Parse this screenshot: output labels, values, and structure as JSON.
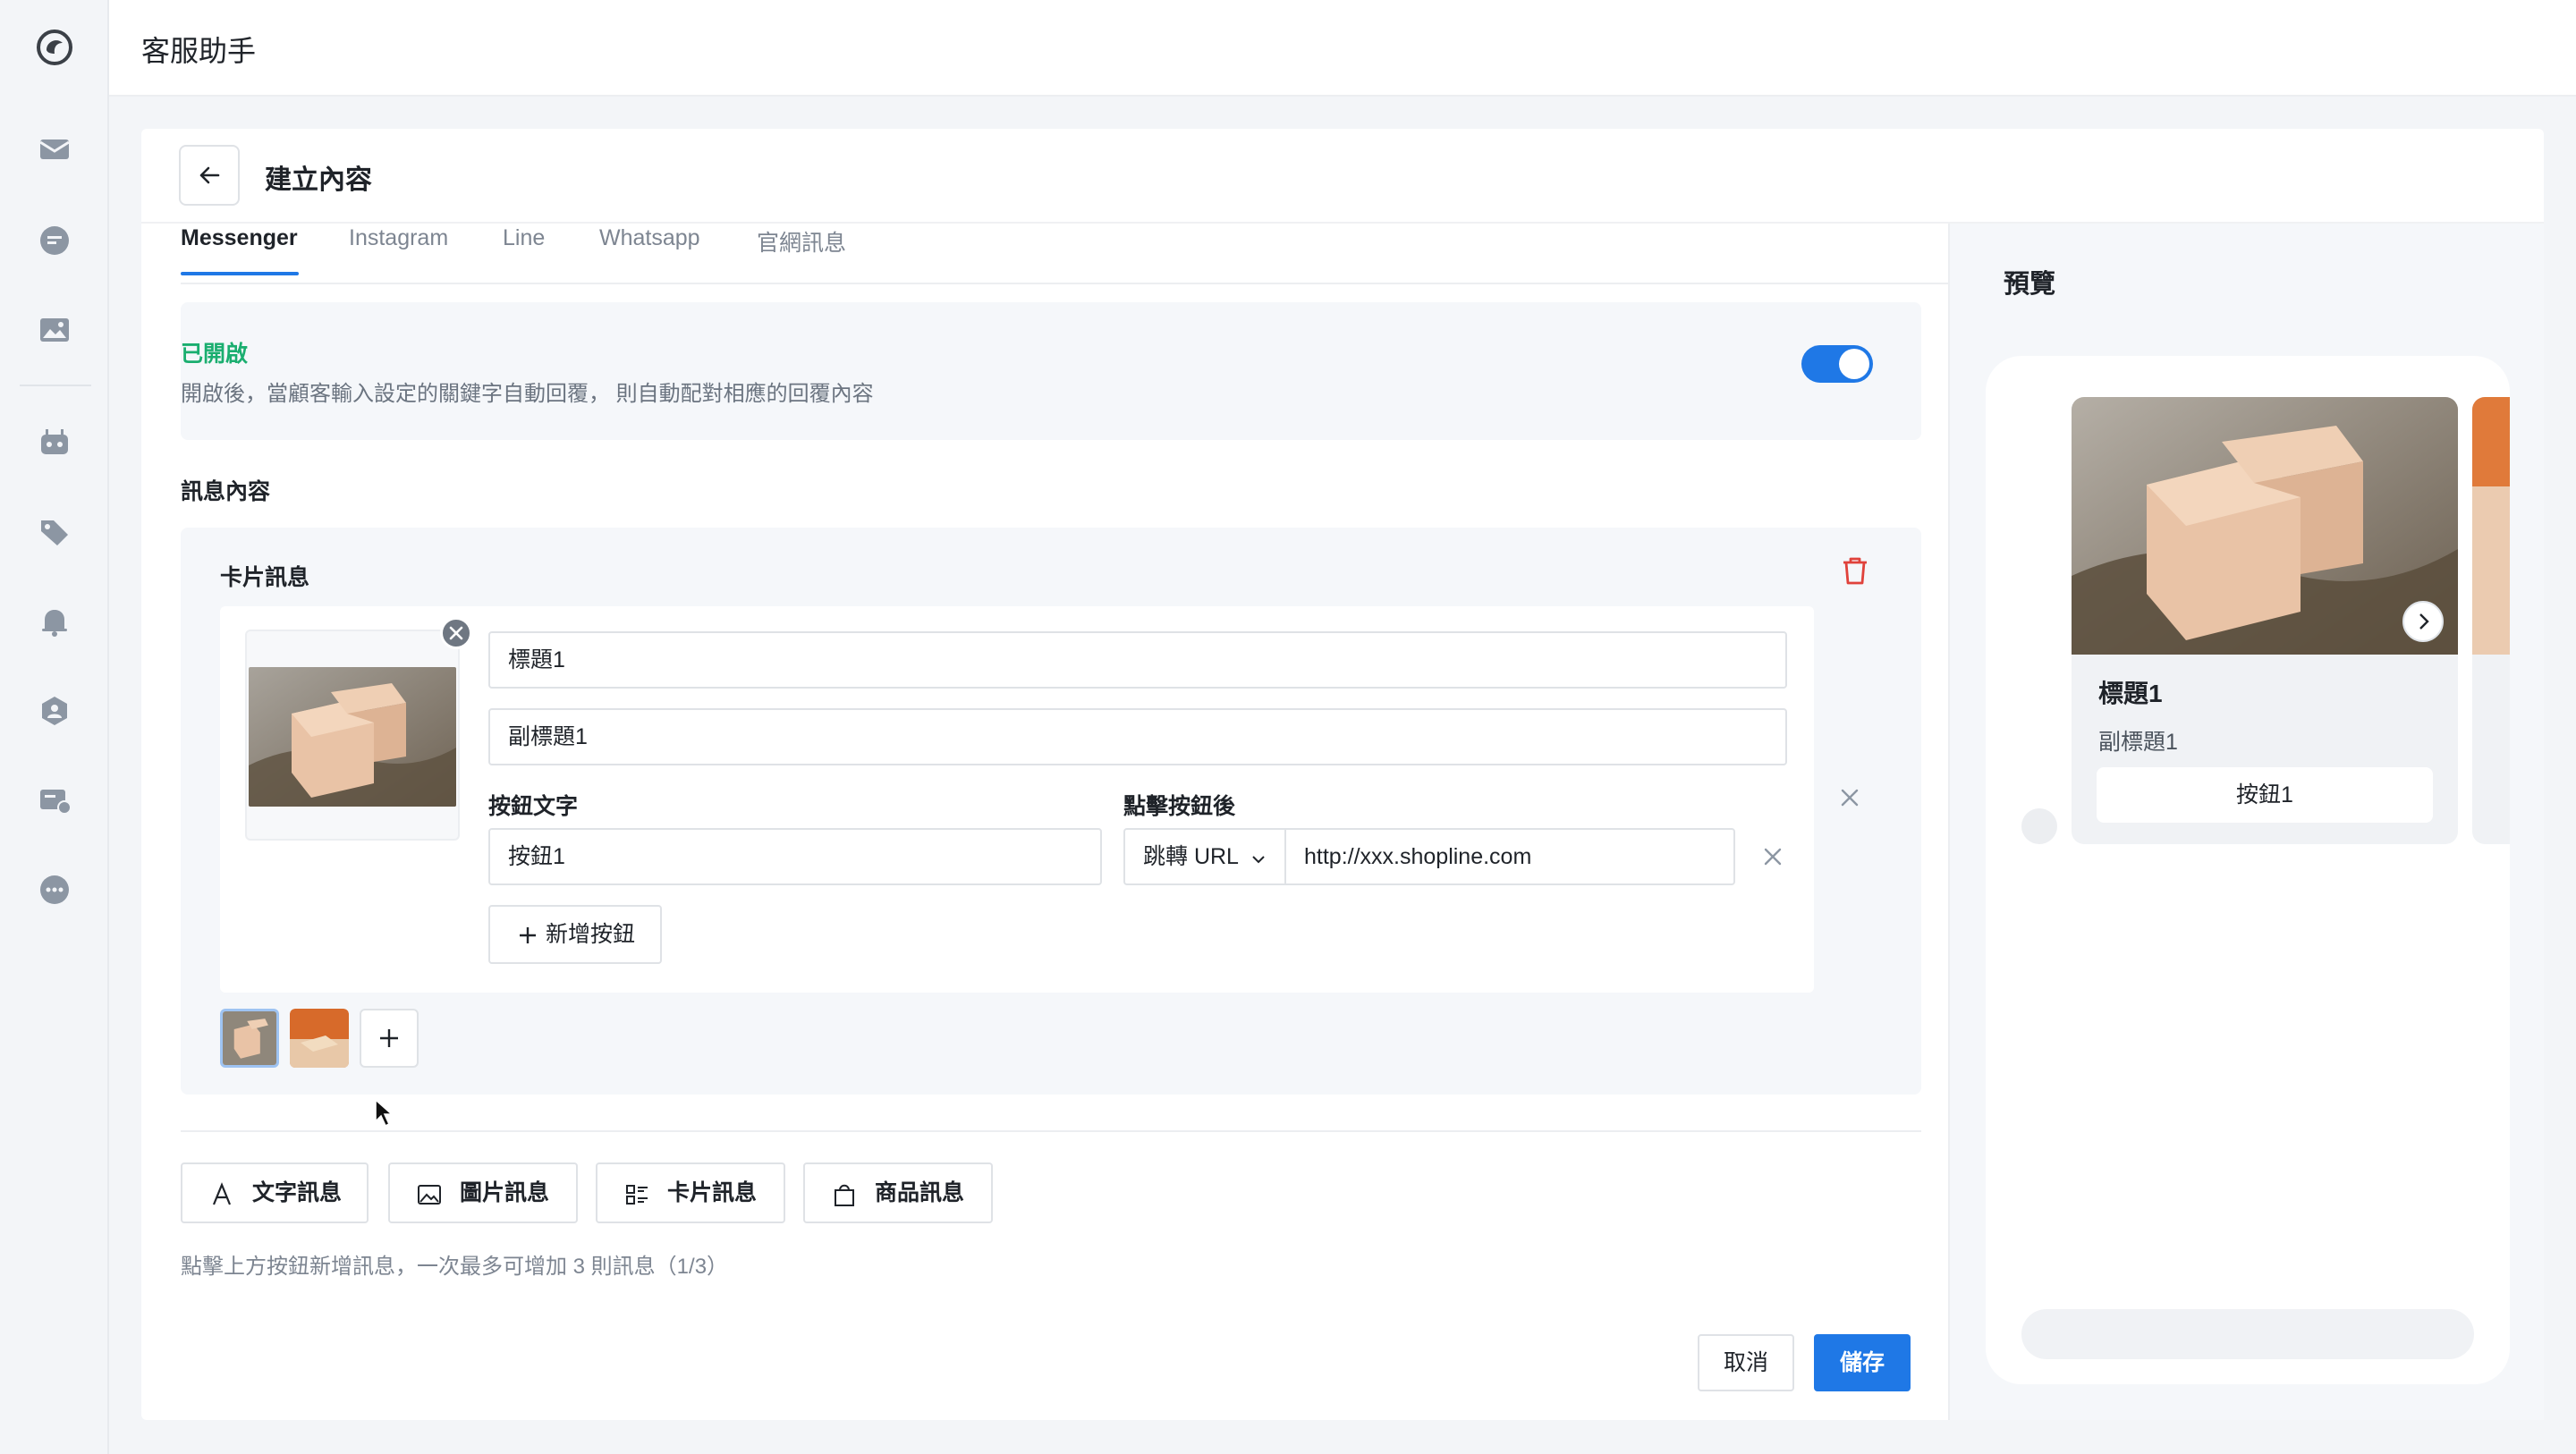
{
  "app": {
    "title": "客服助手"
  },
  "sidebar": {
    "icons": [
      "logo-icon",
      "inbox-icon",
      "chat-icon",
      "image-icon",
      "bot-icon",
      "tag-icon",
      "bell-icon",
      "team-icon",
      "ticket-icon",
      "more-icon"
    ]
  },
  "page": {
    "title": "建立內容",
    "back_icon": "arrow-left-icon"
  },
  "tabs": [
    {
      "label": "Messenger",
      "active": true
    },
    {
      "label": "Instagram"
    },
    {
      "label": "Line"
    },
    {
      "label": "Whatsapp"
    },
    {
      "label": "官網訊息"
    }
  ],
  "toggle": {
    "status": "已開啟",
    "description": "開啟後，當顧客輸入設定的關鍵字自動回覆， 則自動配對相應的回覆內容",
    "on": true,
    "color": "#1f78e6"
  },
  "content": {
    "section_label": "訊息內容",
    "block_title": "卡片訊息",
    "card": {
      "title_value": "標題1",
      "subtitle_value": "副標題1",
      "button_text_label": "按鈕文字",
      "button_text_value": "按鈕1",
      "after_click_label": "點擊按鈕後",
      "action_select": "跳轉 URL",
      "url_value": "http://xxx.shopline.com",
      "add_button_label": "新增按鈕"
    }
  },
  "add_types": [
    {
      "label": "文字訊息",
      "icon": "text-icon"
    },
    {
      "label": "圖片訊息",
      "icon": "image-icon"
    },
    {
      "label": "卡片訊息",
      "icon": "card-list-icon"
    },
    {
      "label": "商品訊息",
      "icon": "shopping-bag-icon"
    }
  ],
  "hint": "點擊上方按鈕新增訊息，一次最多可增加 3 則訊息（1/3）",
  "actions": {
    "cancel": "取消",
    "save": "儲存"
  },
  "preview": {
    "title": "預覽",
    "card_title": "標題1",
    "card_subtitle": "副標題1",
    "card_button": "按鈕1"
  }
}
